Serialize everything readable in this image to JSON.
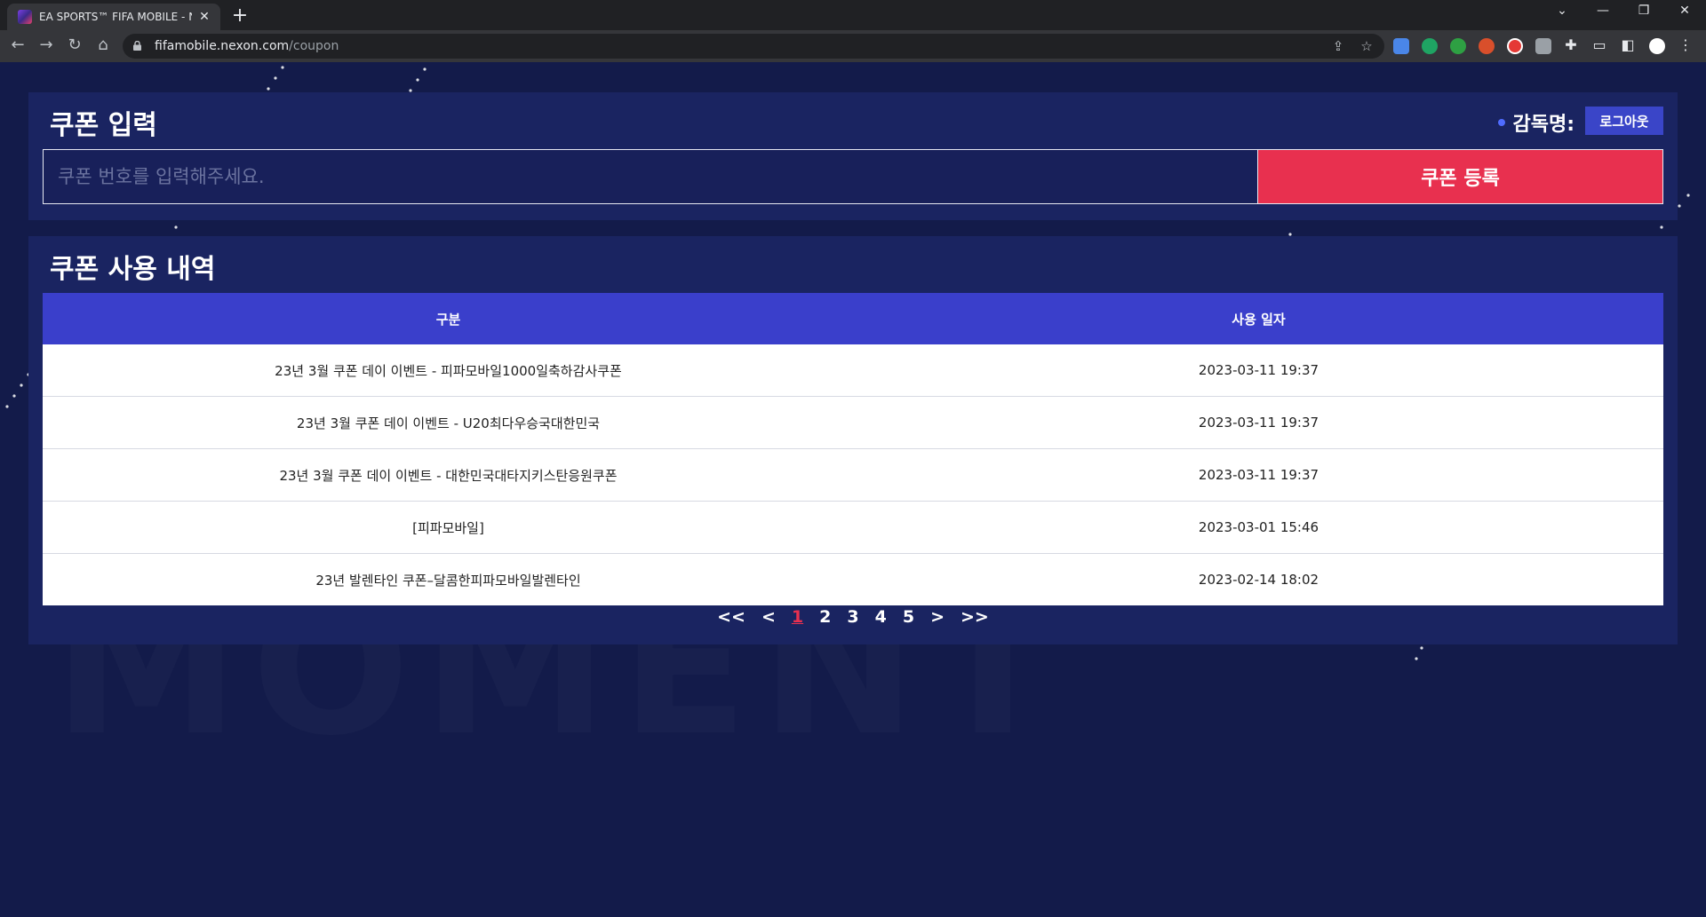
{
  "browser": {
    "tab_title": "EA SPORTS™ FIFA MOBILE - NEXON",
    "url_host": "fifamobile.nexon.com",
    "url_path": "/coupon"
  },
  "coupon_entry": {
    "title": "쿠폰 입력",
    "manager_label": "감독명:",
    "logout_label": "로그아웃",
    "input_placeholder": "쿠폰 번호를 입력해주세요.",
    "submit_label": "쿠폰 등록"
  },
  "history": {
    "title": "쿠폰 사용 내역",
    "columns": [
      "구분",
      "사용 일자"
    ],
    "rows": [
      {
        "type": "23년 3월 쿠폰 데이 이벤트 - 피파모바일1000일축하감사쿠폰",
        "date": "2023-03-11 19:37"
      },
      {
        "type": "23년 3월 쿠폰 데이 이벤트 - U20최다우승국대한민국",
        "date": "2023-03-11 19:37"
      },
      {
        "type": "23년 3월 쿠폰 데이 이벤트 - 대한민국대타지키스탄응원쿠폰",
        "date": "2023-03-11 19:37"
      },
      {
        "type": "[피파모바일]",
        "date": "2023-03-01 15:46"
      },
      {
        "type": "23년 발렌타인 쿠폰–달콤한피파모바일발렌타인",
        "date": "2023-02-14 18:02"
      }
    ]
  },
  "pagination": {
    "first": "<<",
    "prev": "<",
    "pages": [
      "1",
      "2",
      "3",
      "4",
      "5"
    ],
    "current": "1",
    "next": ">",
    "last": ">>"
  },
  "colors": {
    "background": "#131b4a",
    "panel": "#1a2461",
    "table_header": "#3a3fcb",
    "accent_red": "#e8304f",
    "logout_button": "#3a45c8"
  }
}
